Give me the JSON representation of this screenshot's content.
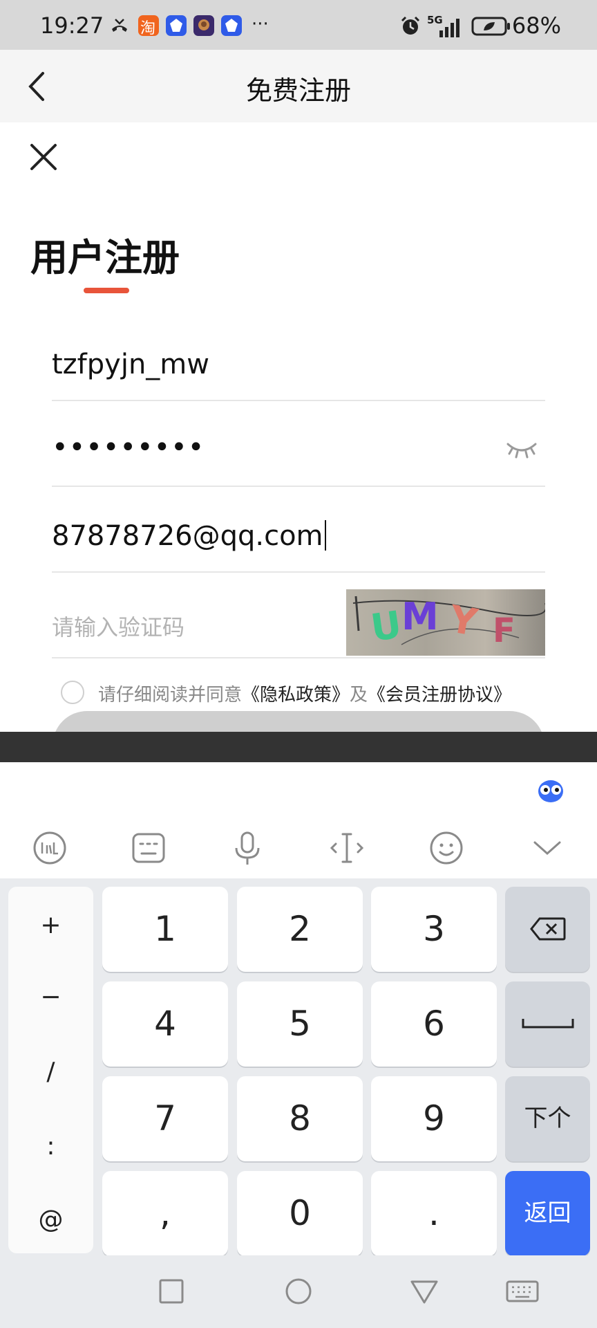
{
  "status_bar": {
    "time": "19:27",
    "network": "5G",
    "battery": "68%",
    "more": "···",
    "taobao_label": "淘"
  },
  "header": {
    "title": "免费注册"
  },
  "form": {
    "heading": "用户注册",
    "username_value": "tzfpyjn_mw",
    "password_value": "•••••••••",
    "email_value": "87878726@qq.com",
    "captcha_placeholder": "请输入验证码",
    "captcha_text": [
      "U",
      "M",
      "Y",
      "F"
    ],
    "agree_prefix": "请仔细阅读并同意",
    "privacy_link": "《隐私政策》",
    "agree_and": "及",
    "member_link": "《会员注册协议》"
  },
  "keyboard": {
    "symbols": [
      "+",
      "−",
      "/",
      ":",
      "@"
    ],
    "digits": [
      [
        "1",
        "2",
        "3"
      ],
      [
        "4",
        "5",
        "6"
      ],
      [
        "7",
        "8",
        "9"
      ],
      [
        ",",
        "0",
        "."
      ]
    ],
    "next_label": "下个",
    "return_label": "返回"
  },
  "colors": {
    "accent": "#e8543a",
    "keyboard_primary": "#3b6ef5"
  }
}
